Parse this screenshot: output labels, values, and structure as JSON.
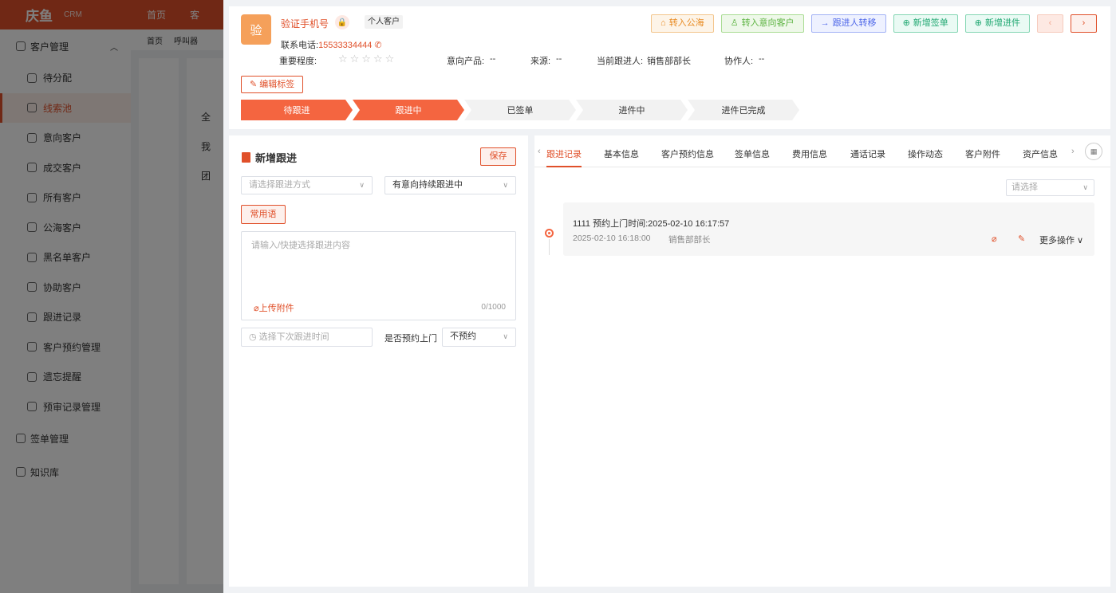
{
  "bg": {
    "logo": "庆鱼",
    "logo_sub": "CRM",
    "topnav": [
      "首页",
      "客"
    ],
    "tabs": [
      "首页",
      "呼叫器"
    ],
    "sidebar_group": "客户管理",
    "sidebar_items": [
      "待分配",
      "线索池",
      "意向客户",
      "成交客户",
      "所有客户",
      "公海客户",
      "黑名单客户",
      "协助客户",
      "跟进记录",
      "客户预约管理",
      "遗忘提醒",
      "预审记录管理"
    ],
    "sidebar_bottom": [
      "签单管理",
      "知识库"
    ],
    "col_labels": [
      "全",
      "我",
      "团"
    ]
  },
  "customer": {
    "avatar_char": "验",
    "name": "验证手机号",
    "type_tag": "个人客户",
    "phone_label": "联系电话:",
    "phone": "15533334444",
    "importance_label": "重要程度:",
    "stars": "☆☆☆☆☆",
    "product_label": "意向产品:",
    "product": "--",
    "source_label": "来源:",
    "source": "--",
    "follower_label": "当前跟进人:",
    "follower": "销售部部长",
    "partner_label": "协作人:",
    "partner": "--",
    "edit_tag": "编辑标签"
  },
  "actions": {
    "to_pool": "转入公海",
    "to_intent": "转入意向客户",
    "transfer": "跟进人转移",
    "add_sign": "新增签单",
    "add_progress": "新增进件"
  },
  "stages": [
    "待跟进",
    "跟进中",
    "已签单",
    "进件中",
    "进件已完成"
  ],
  "followup": {
    "title": "新增跟进",
    "save": "保存",
    "method_placeholder": "请选择跟进方式",
    "status_value": "有意向持续跟进中",
    "common_phrases": "常用语",
    "content_placeholder": "请输入/快捷选择跟进内容",
    "upload": "上传附件",
    "counter": "0/1000",
    "next_time_placeholder": "选择下次跟进时间",
    "visit_label": "是否预约上门",
    "visit_value": "不预约"
  },
  "tabs": [
    "跟进记录",
    "基本信息",
    "客户预约信息",
    "签单信息",
    "费用信息",
    "通话记录",
    "操作动态",
    "客户附件",
    "资产信息"
  ],
  "filter_placeholder": "请选择",
  "record": {
    "title": "1111 预约上门时间:2025-02-10 16:17:57",
    "time": "2025-02-10 16:18:00",
    "user": "销售部部长",
    "more": "更多操作"
  }
}
